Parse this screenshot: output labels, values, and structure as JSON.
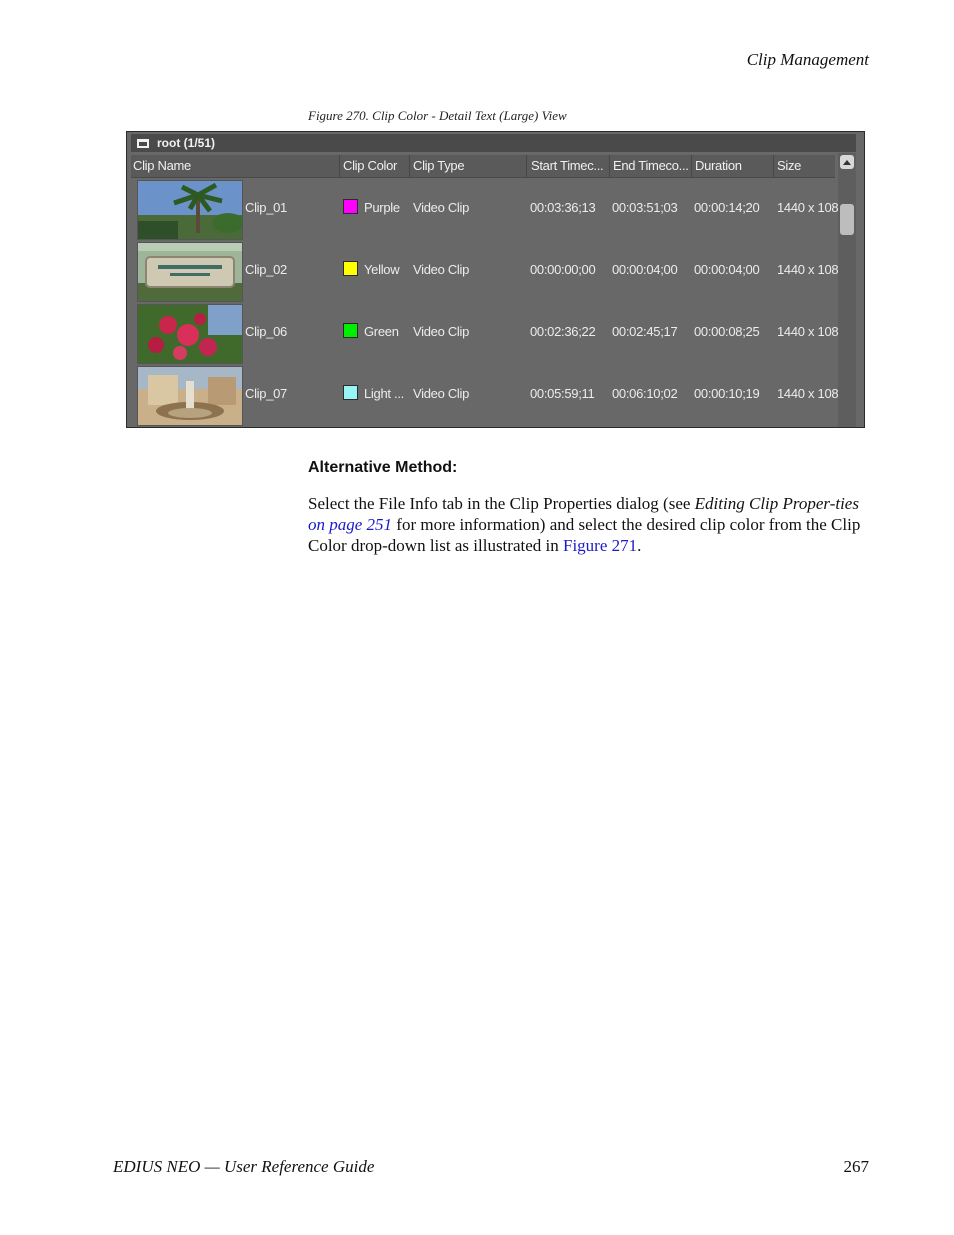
{
  "header": {
    "section": "Clip Management"
  },
  "figure": {
    "caption": "Figure 270.  Clip Color - Detail Text (Large) View",
    "bin_title": "root (1/51)",
    "columns": [
      "Clip Name",
      "Clip Color",
      "Clip Type",
      "Start Timec...",
      "End Timeco...",
      "Duration",
      "Size"
    ],
    "clips": [
      {
        "name": "Clip_01",
        "color_label": "Purple",
        "color_hex": "#ff00ff",
        "type": "Video Clip",
        "start": "00:03:36;13",
        "end": "00:03:51;03",
        "duration": "00:00:14;20",
        "size": "1440 x 108"
      },
      {
        "name": "Clip_02",
        "color_label": "Yellow",
        "color_hex": "#ffff00",
        "type": "Video Clip",
        "start": "00:00:00;00",
        "end": "00:00:04;00",
        "duration": "00:00:04;00",
        "size": "1440 x 108"
      },
      {
        "name": "Clip_06",
        "color_label": "Green",
        "color_hex": "#00ee00",
        "type": "Video Clip",
        "start": "00:02:36;22",
        "end": "00:02:45;17",
        "duration": "00:00:08;25",
        "size": "1440 x 108"
      },
      {
        "name": "Clip_07",
        "color_label": "Light ...",
        "color_hex": "#99f5f5",
        "type": "Video Clip",
        "start": "00:05:59;11",
        "end": "00:06:10;02",
        "duration": "00:00:10;19",
        "size": "1440 x 108"
      }
    ]
  },
  "body": {
    "heading": "Alternative Method:",
    "p1": "Select the File Info tab in the Clip Properties dialog (see ",
    "ref_title": "Editing Clip Proper-ties",
    "ref_page": "on page 251",
    "p2": " for more information) and select the desired clip color from the Clip Color drop-down list as illustrated in ",
    "fig_link": "Figure 271",
    "p3": "."
  },
  "footer": {
    "title": "EDIUS NEO  —  User Reference Guide",
    "page": "267"
  }
}
